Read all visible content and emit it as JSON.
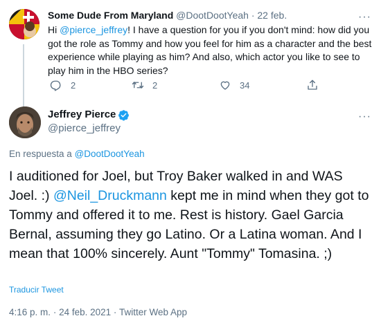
{
  "parent_tweet": {
    "display_name": "Some Dude From Maryland",
    "handle": "@DootDootYeah",
    "separator": "·",
    "date": "22 feb.",
    "text_prefix": "Hi ",
    "mention": "@pierce_jeffrey",
    "text_body": "! I have a question for you if you don't mind: how did you got the role as Tommy and how you feel for him as a character and the best experience while playing as him? And also, which actor you like to see to play him in the HBO series?",
    "reply_count": "2",
    "retweet_count": "2",
    "like_count": "34",
    "more_glyph": "···"
  },
  "main_tweet": {
    "display_name": "Jeffrey Pierce",
    "handle": "@pierce_jeffrey",
    "more_glyph": "···",
    "reply_label": "En respuesta a ",
    "reply_handle": "@DootDootYeah",
    "text_part1": "I auditioned for Joel, but Troy Baker walked in and WAS Joel. :) ",
    "mention": "@Neil_Druckmann",
    "text_part2": " kept me in mind when they got to Tommy and offered it to me. Rest is history. Gael Garcia Bernal, assuming they go Latino. Or a Latina woman. And I mean that 100% sincerely. Aunt \"Tommy\" Tomasina. ;)",
    "translate_label": "Traducir Tweet",
    "time": "4:16 p. m.",
    "separator": "·",
    "date": "24 feb. 2021",
    "source": "Twitter Web App"
  },
  "colors": {
    "link": "#1b95e0",
    "muted": "#5b7083",
    "verified": "#1da1f2",
    "text": "#0f1419"
  },
  "icons": [
    "reply-icon",
    "retweet-icon",
    "like-icon",
    "share-icon",
    "verified-badge-icon",
    "more-icon"
  ]
}
